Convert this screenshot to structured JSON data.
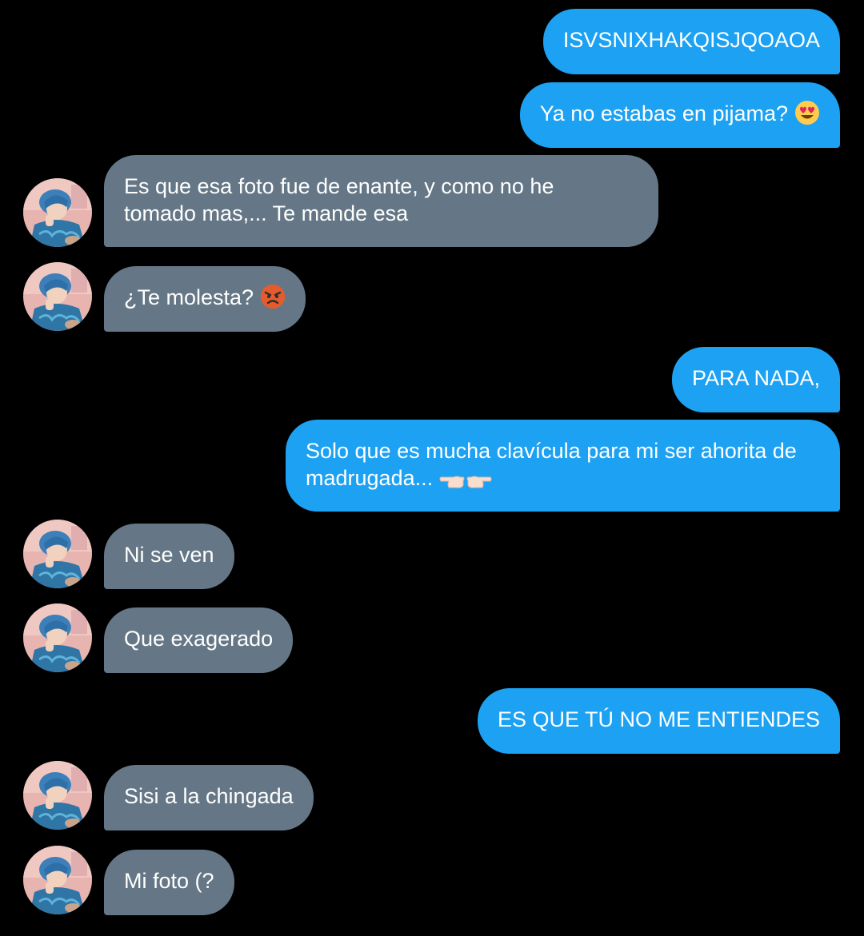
{
  "conversation": {
    "messages": [
      {
        "direction": "outgoing",
        "text": "ISVSNIXHAKQISJQOAOA"
      },
      {
        "direction": "outgoing",
        "text": "Ya no estabas en pijama?",
        "emoji": "heart-eyes-emoji"
      },
      {
        "direction": "incoming",
        "text": "Es que esa foto fue de enante, y como no he\ntomado mas,... Te mande esa"
      },
      {
        "direction": "incoming",
        "text": "¿Te molesta?",
        "emoji": "angry-face-emoji"
      },
      {
        "direction": "outgoing",
        "text": "PARA NADA,"
      },
      {
        "direction": "outgoing",
        "text": "Solo que es mucha clavícula para mi ser ahorita de\nmadrugada...",
        "emoji": "pointing-fingers-emoji"
      },
      {
        "direction": "incoming",
        "text": "Ni se ven"
      },
      {
        "direction": "incoming",
        "text": "Que exagerado"
      },
      {
        "direction": "outgoing",
        "text": "ES QUE TÚ NO ME ENTIENDES"
      },
      {
        "direction": "incoming",
        "text": "Sisi a la chingada"
      },
      {
        "direction": "incoming",
        "text": "Mi foto (?"
      }
    ]
  },
  "theme": {
    "background": "#000000",
    "outgoing_bubble": "#1da1f2",
    "incoming_bubble": "#657786",
    "text": "#ffffff"
  },
  "avatar_icon": "contact-avatar-photo"
}
